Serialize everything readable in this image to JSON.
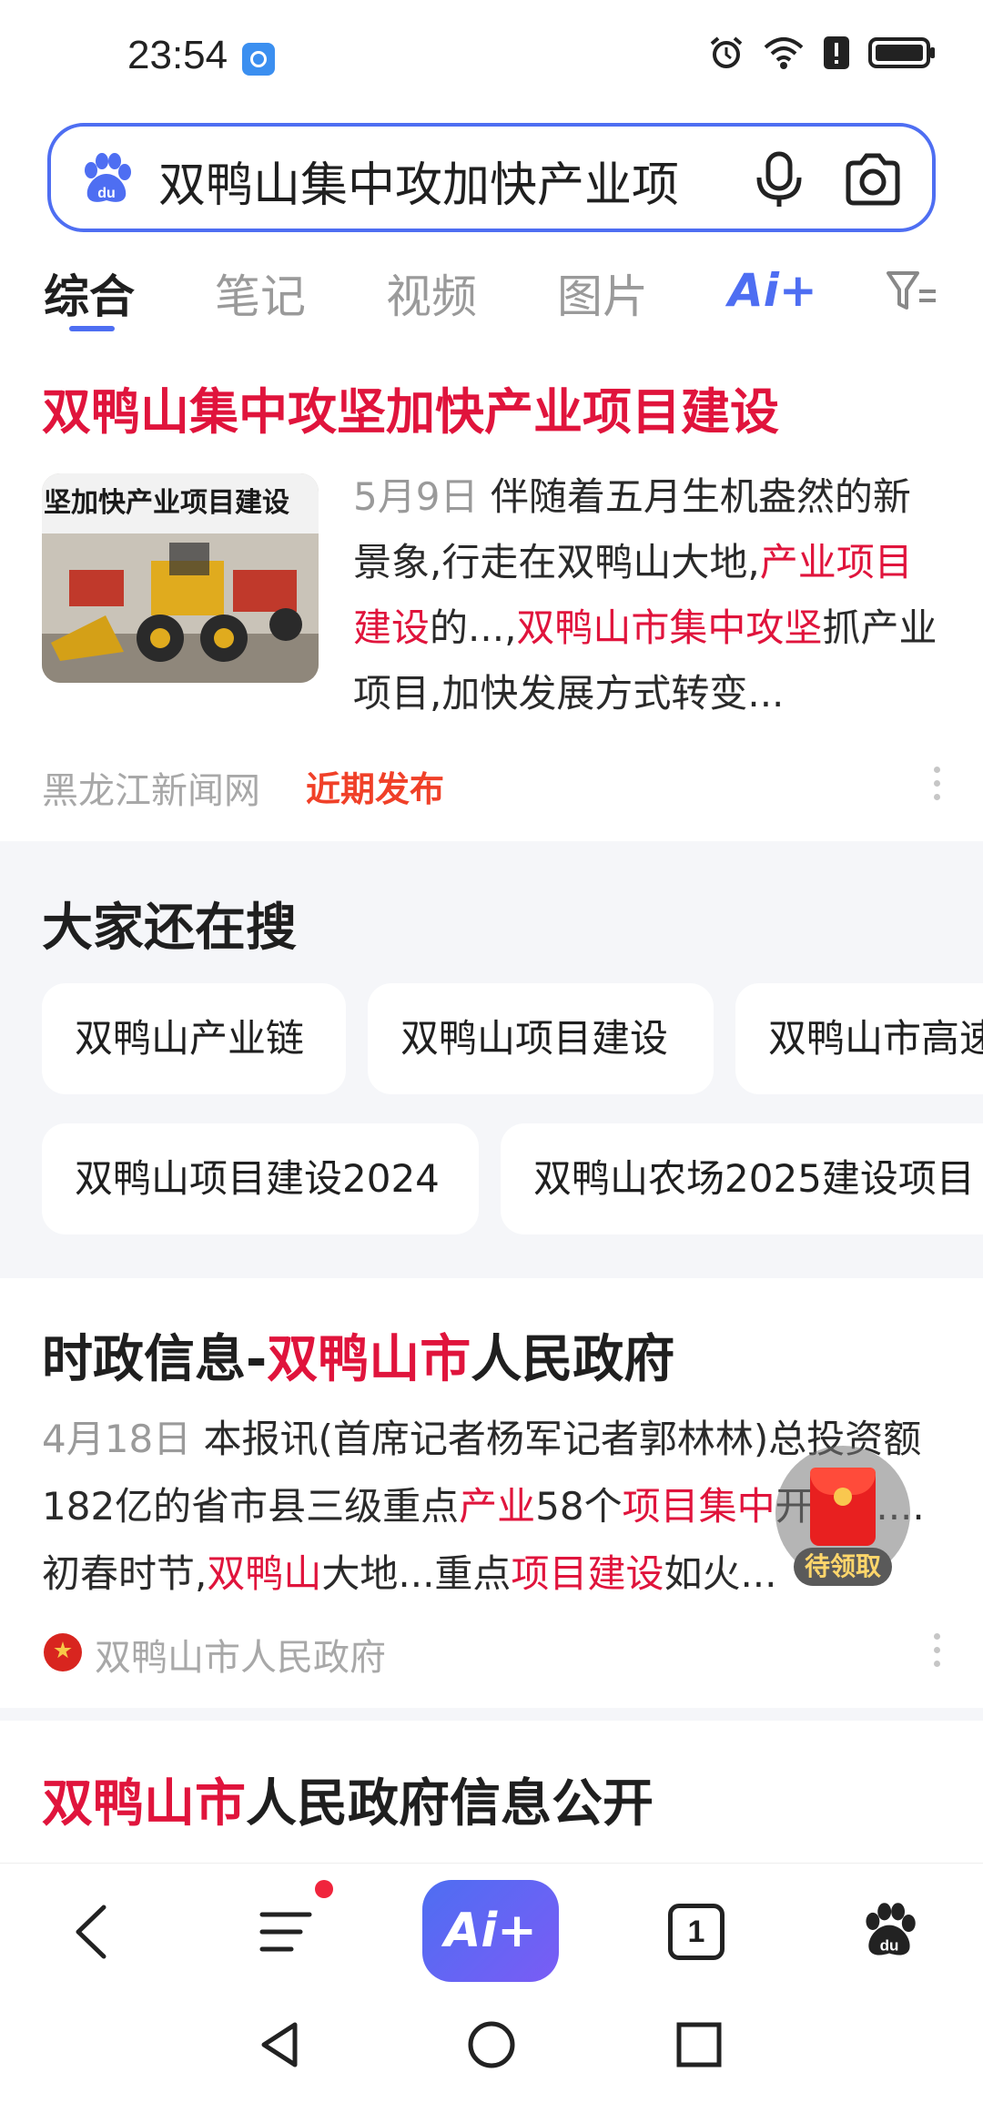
{
  "status": {
    "time": "23:54",
    "icons": [
      "clock-app-icon",
      "alarm-icon",
      "wifi-icon",
      "alert-icon",
      "battery-icon"
    ]
  },
  "search": {
    "query": "双鸭山集中攻加快产业项",
    "logo": "baidu-paw-icon",
    "voice_icon": "mic-icon",
    "camera_icon": "camera-icon"
  },
  "tabs": {
    "items": [
      "综合",
      "笔记",
      "视频",
      "图片"
    ],
    "active": "综合",
    "ai_label": "Ai+",
    "filter_icon": "filter-icon"
  },
  "result1": {
    "title": "双鸭山集中攻坚加快产业项目建设",
    "image_caption": "坚加快产业项目建设",
    "date": "5月9日",
    "snippet_a": "伴随着五月生机盎然的新景象,行走在双鸭山大地,",
    "snippet_b": "产业项目建设",
    "snippet_c": "的...,",
    "snippet_d": "双鸭山市集中攻坚",
    "snippet_e": "抓产业项目,加快发展方式转变...",
    "source": "黑龙江新闻网",
    "badge": "近期发布"
  },
  "related": {
    "title": "大家还在搜",
    "chips": [
      "双鸭山产业链",
      "双鸭山项目建设",
      "双鸭山市高速",
      "双鸭山项目建设2024",
      "双鸭山农场2025建设项目"
    ]
  },
  "result2": {
    "title_a": "时政信息-",
    "title_b": "双鸭山市",
    "title_c": "人民政府",
    "date": "4月18日",
    "s1": "本报讯(首席记者杨军记者郭林林)总投资额182亿的省市县三级重点",
    "s2": "产业",
    "s3": "58个",
    "s4": "项目集中",
    "s5": "开工......初春时节,",
    "s6": "双鸭山",
    "s7": "大地...重点",
    "s8": "项目建设",
    "s9": "如火...",
    "source": "双鸭山市人民政府"
  },
  "result3": {
    "title_a": "双鸭山市",
    "title_b": "人民政府信息公开"
  },
  "red_packet": {
    "label": "待领取"
  },
  "bottom_nav": {
    "ai_label": "Ai+",
    "tab_count": "1"
  },
  "colors": {
    "accent": "#4e6ef2",
    "highlight": "#e0143c",
    "badge": "#f04028"
  }
}
